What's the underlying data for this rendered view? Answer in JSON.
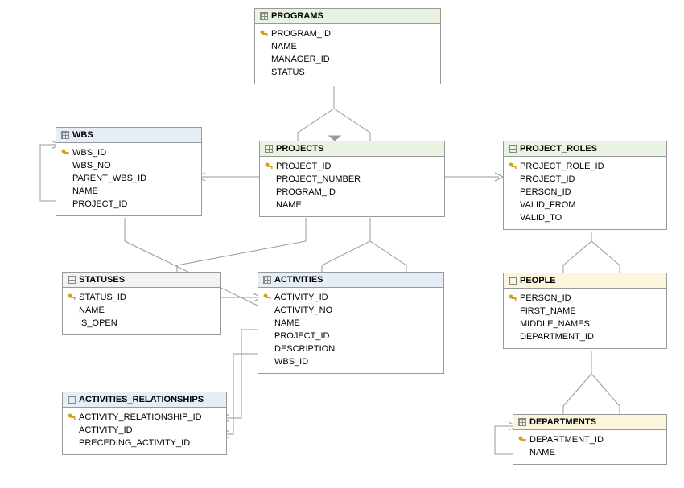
{
  "tables": {
    "programs": {
      "name": "PROGRAMS",
      "columns": [
        {
          "key": true,
          "label": "PROGRAM_ID"
        },
        {
          "key": false,
          "label": "NAME"
        },
        {
          "key": false,
          "label": "MANAGER_ID"
        },
        {
          "key": false,
          "label": "STATUS"
        }
      ]
    },
    "wbs": {
      "name": "WBS",
      "columns": [
        {
          "key": true,
          "label": "WBS_ID"
        },
        {
          "key": false,
          "label": "WBS_NO"
        },
        {
          "key": false,
          "label": "PARENT_WBS_ID"
        },
        {
          "key": false,
          "label": "NAME"
        },
        {
          "key": false,
          "label": "PROJECT_ID"
        }
      ]
    },
    "projects": {
      "name": "PROJECTS",
      "columns": [
        {
          "key": true,
          "label": "PROJECT_ID"
        },
        {
          "key": false,
          "label": "PROJECT_NUMBER"
        },
        {
          "key": false,
          "label": "PROGRAM_ID"
        },
        {
          "key": false,
          "label": "NAME"
        }
      ]
    },
    "project_roles": {
      "name": "PROJECT_ROLES",
      "columns": [
        {
          "key": true,
          "label": "PROJECT_ROLE_ID"
        },
        {
          "key": false,
          "label": "PROJECT_ID"
        },
        {
          "key": false,
          "label": "PERSON_ID"
        },
        {
          "key": false,
          "label": "VALID_FROM"
        },
        {
          "key": false,
          "label": "VALID_TO"
        }
      ]
    },
    "statuses": {
      "name": "STATUSES",
      "columns": [
        {
          "key": true,
          "label": "STATUS_ID"
        },
        {
          "key": false,
          "label": "NAME"
        },
        {
          "key": false,
          "label": "IS_OPEN"
        }
      ]
    },
    "activities": {
      "name": "ACTIVITIES",
      "columns": [
        {
          "key": true,
          "label": "ACTIVITY_ID"
        },
        {
          "key": false,
          "label": "ACTIVITY_NO"
        },
        {
          "key": false,
          "label": "NAME"
        },
        {
          "key": false,
          "label": "PROJECT_ID"
        },
        {
          "key": false,
          "label": "DESCRIPTION"
        },
        {
          "key": false,
          "label": "WBS_ID"
        }
      ]
    },
    "people": {
      "name": "PEOPLE",
      "columns": [
        {
          "key": true,
          "label": "PERSON_ID"
        },
        {
          "key": false,
          "label": "FIRST_NAME"
        },
        {
          "key": false,
          "label": "MIDDLE_NAMES"
        },
        {
          "key": false,
          "label": "DEPARTMENT_ID"
        }
      ]
    },
    "activities_relationships": {
      "name": "ACTIVITIES_RELATIONSHIPS",
      "columns": [
        {
          "key": true,
          "label": "ACTIVITY_RELATIONSHIP_ID"
        },
        {
          "key": false,
          "label": "ACTIVITY_ID"
        },
        {
          "key": false,
          "label": "PRECEDING_ACTIVITY_ID"
        }
      ]
    },
    "departments": {
      "name": "DEPARTMENTS",
      "columns": [
        {
          "key": true,
          "label": "DEPARTMENT_ID"
        },
        {
          "key": false,
          "label": "NAME"
        }
      ]
    }
  },
  "relationships": [
    {
      "from": "programs",
      "to": "projects"
    },
    {
      "from": "projects",
      "to": "wbs"
    },
    {
      "from": "projects",
      "to": "project_roles"
    },
    {
      "from": "projects",
      "to": "activities"
    },
    {
      "from": "projects",
      "to": "statuses"
    },
    {
      "from": "wbs",
      "to": "wbs"
    },
    {
      "from": "wbs",
      "to": "activities"
    },
    {
      "from": "statuses",
      "to": "activities"
    },
    {
      "from": "activities",
      "to": "activities_relationships"
    },
    {
      "from": "activities",
      "to": "activities_relationships"
    },
    {
      "from": "project_roles",
      "to": "people"
    },
    {
      "from": "people",
      "to": "departments"
    },
    {
      "from": "departments",
      "to": "departments"
    }
  ]
}
